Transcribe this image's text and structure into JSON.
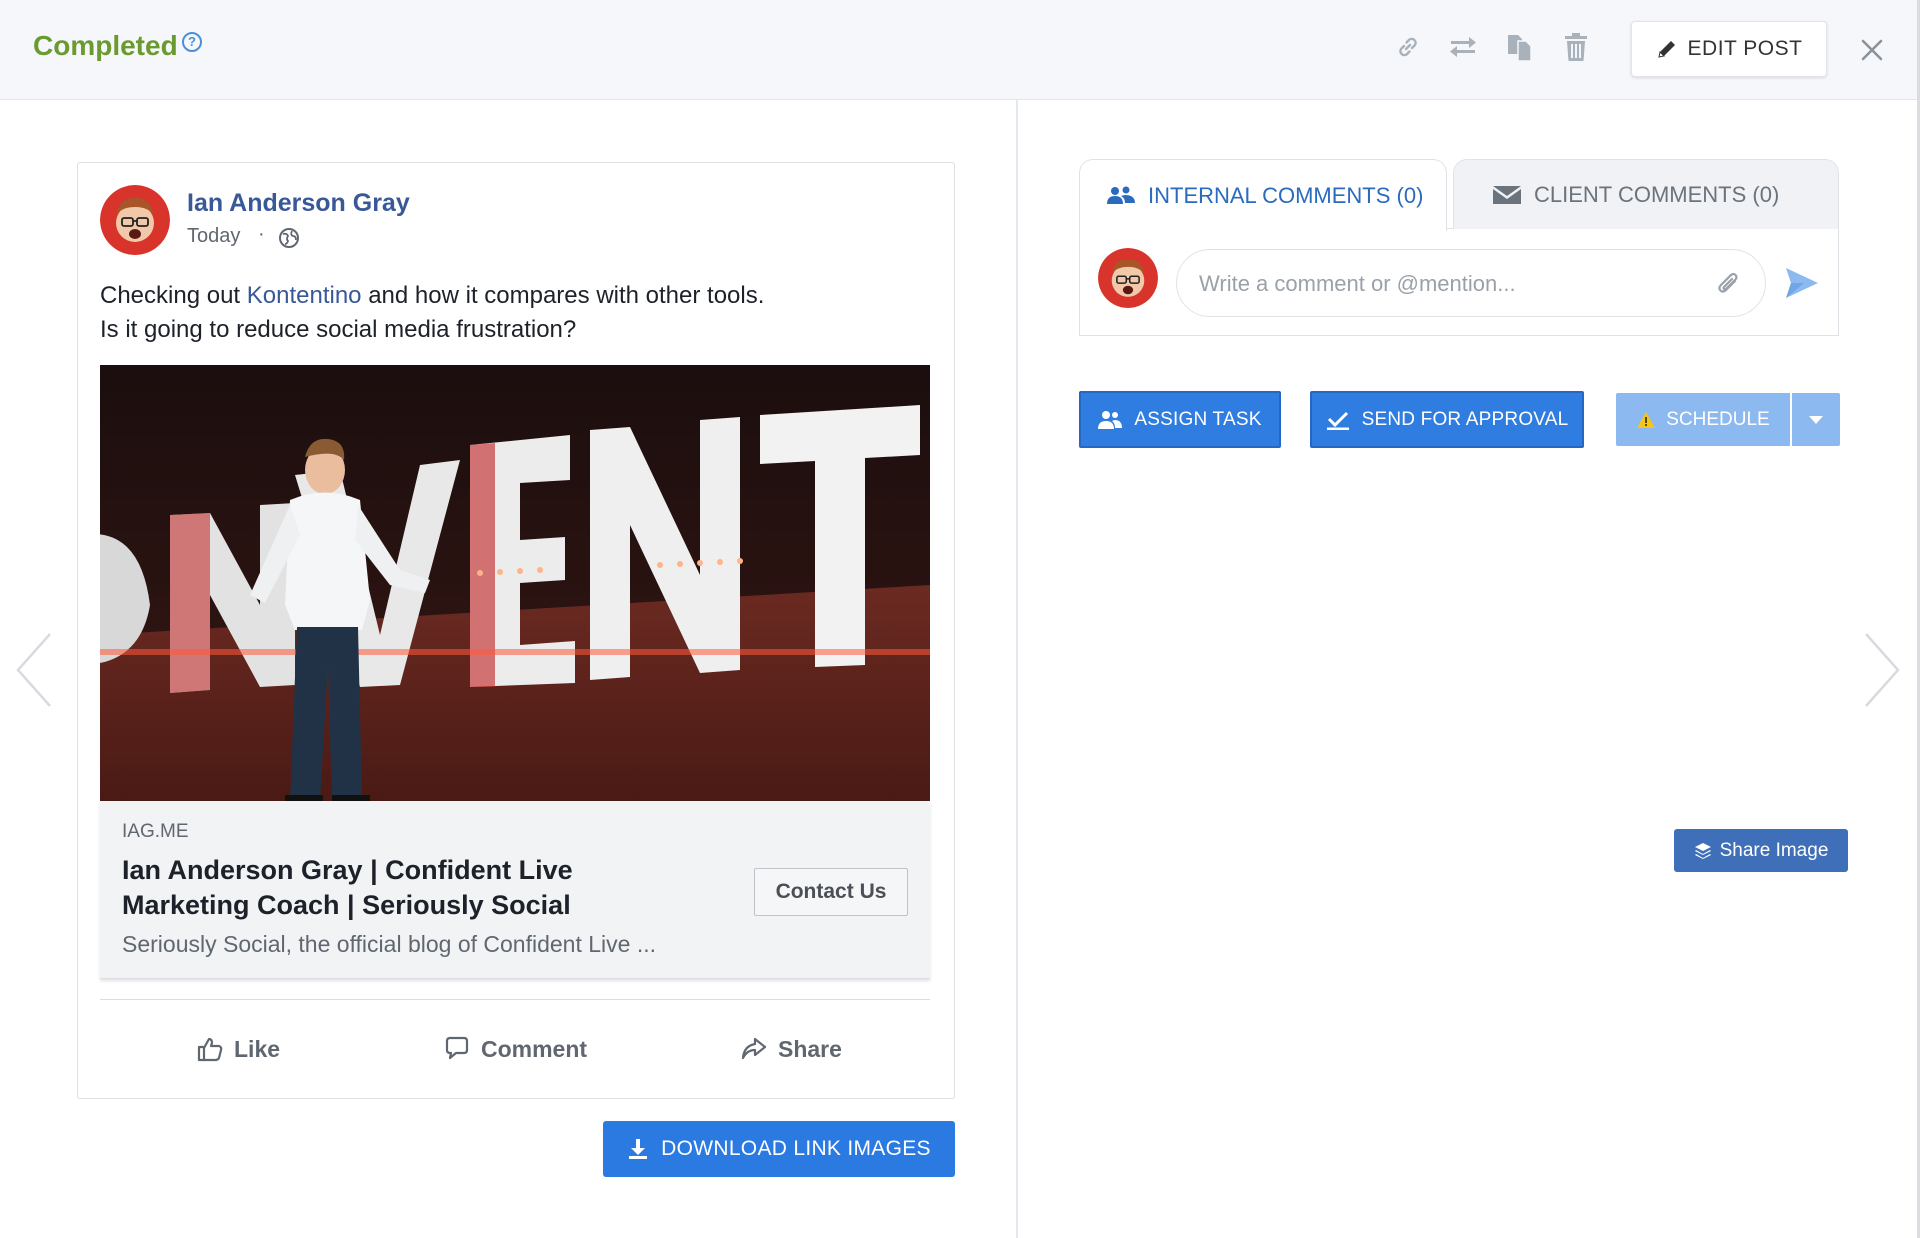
{
  "header": {
    "status": "Completed",
    "help_glyph": "?",
    "icons": [
      "link-icon",
      "swap-icon",
      "copy-icon",
      "trash-icon",
      "close-icon"
    ],
    "edit_post_label": "EDIT POST"
  },
  "post": {
    "author": "Ian Anderson Gray",
    "date": "Today",
    "separator": "·",
    "text_line1_before": "Checking out ",
    "text_link": "Kontentino",
    "text_line1_after": " and how it compares with other tools.",
    "text_line2": "Is it going to reduce social media frustration?",
    "link_preview": {
      "domain": "IAG.ME",
      "title": "Ian Anderson Gray | Confident Live Marketing Coach | Seriously Social",
      "description": "Seriously Social, the official blog of Confident Live ...",
      "cta": "Contact Us"
    },
    "actions": {
      "like": "Like",
      "comment": "Comment",
      "share": "Share"
    }
  },
  "download_button": "DOWNLOAD LINK IMAGES",
  "comments": {
    "tab_internal": "INTERNAL COMMENTS (0)",
    "tab_client": "CLIENT COMMENTS (0)",
    "placeholder": "Write a comment or @mention..."
  },
  "actions": {
    "assign_task": "ASSIGN TASK",
    "send_for_approval": "SEND FOR APPROVAL",
    "schedule": "SCHEDULE",
    "share_image": "Share Image"
  },
  "colors": {
    "status": "#6b9a2f",
    "primary": "#2f7de1",
    "schedule": "#8cb9ef",
    "facebook_link": "#385898"
  }
}
